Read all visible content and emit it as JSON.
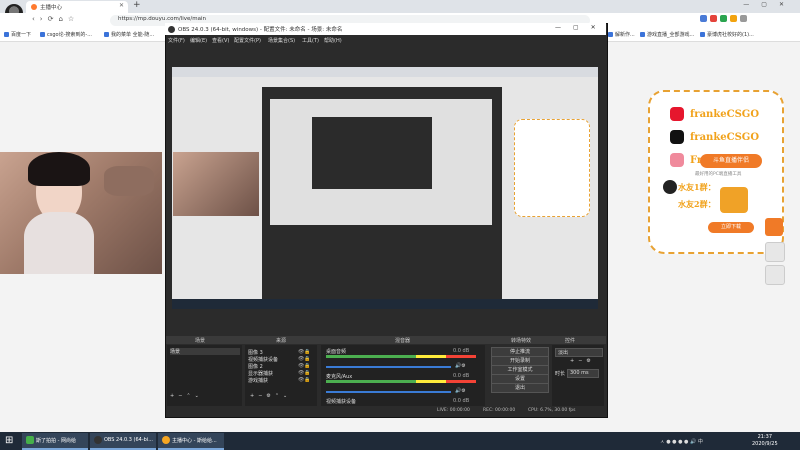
{
  "browser": {
    "tab_title": "主播中心",
    "url": "https://mp.douyu.com/live/main",
    "bookmarks": [
      "百度一下",
      "csgo论-搜索到的-...",
      "我的菜单 全能-随...",
      "解新作...",
      "游戏直播_全部游戏...",
      "豪博虎社校好的(1)..."
    ]
  },
  "obs": {
    "title": "OBS 24.0.3 (64-bit, windows) - 配置文件: 未命名 - 场景: 未命名",
    "menu": [
      "文件(F)",
      "编辑(E)",
      "查看(V)",
      "配置文件(P)",
      "场景集合(S)",
      "工具(T)",
      "帮助(H)"
    ],
    "docks": {
      "scenes": "场景",
      "sources": "来源",
      "mixer": "混音器",
      "transitions": "转场特效",
      "controls": "控件"
    },
    "scene_items": [
      "场景"
    ],
    "source_items": [
      "图像 3",
      "视频捕获设备",
      "图像 2",
      "显示器捕获",
      "游戏捕获"
    ],
    "mixer_tracks": [
      "桌面音频",
      "麦克风/Aux",
      "视频捕获设备"
    ],
    "mixer_values": [
      "0.0 dB",
      "0.0 dB",
      "0.0 dB"
    ],
    "transition": {
      "name": "淡出",
      "duration_label": "时长",
      "duration_value": "300 ms"
    },
    "controls": [
      "停止推流",
      "开始录制",
      "工作室模式",
      "设置",
      "退出"
    ],
    "status": {
      "live": "LIVE: 00:00:00",
      "rec": "REC: 00:00:00",
      "cpu": "CPU: 6.7%, 30.00 fps"
    }
  },
  "promo": {
    "rows": [
      "frankeCSGO",
      "frankeCSGO",
      "Franke...",
      "水友1群：",
      "水友2群："
    ],
    "badge": "斗鱼直播伴侣",
    "sub": "最好用的PC端直播工具",
    "download": "立即下载"
  },
  "taskbar": {
    "apps": [
      "斯了拍拍 - 网尚给",
      "OBS 24.0.3 (64-bi...",
      "主播中心 - 斯给给..."
    ],
    "time": "21:37",
    "date": "2020/9/25"
  },
  "colors": {
    "accent": "#f1a21b",
    "obs_bg": "#2b2b2b",
    "taskbar": "#1f2a38"
  }
}
